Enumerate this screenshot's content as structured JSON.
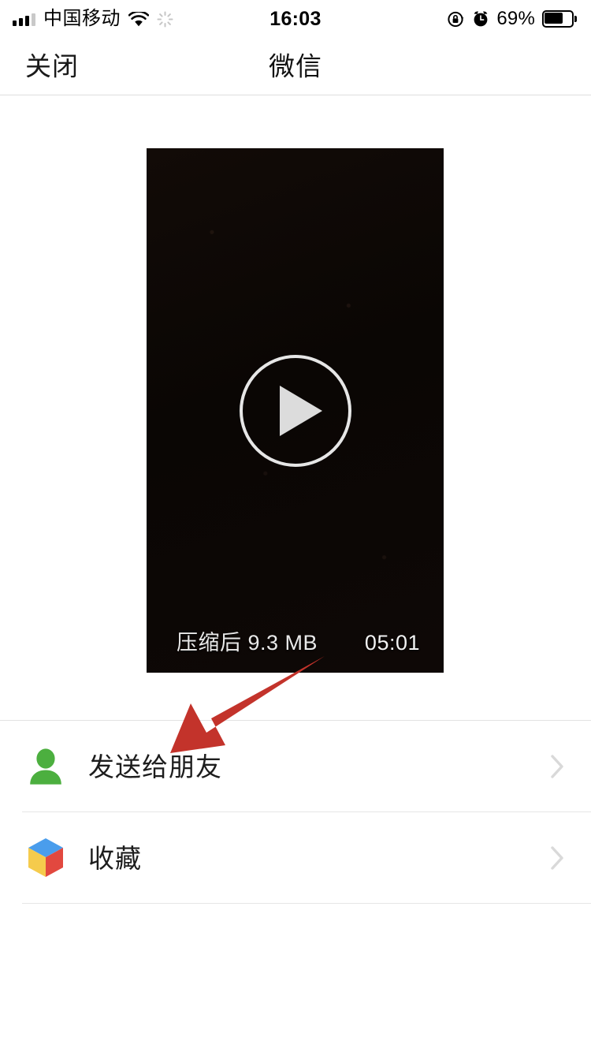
{
  "status_bar": {
    "carrier": "中国移动",
    "time": "16:03",
    "battery_percent": "69%",
    "signal_bars_filled": 3,
    "signal_bars_total": 4,
    "icons": [
      "signal-bars-icon",
      "wifi-icon",
      "activity-spinner-icon",
      "rotation-lock-icon",
      "alarm-clock-icon",
      "battery-icon"
    ]
  },
  "navbar": {
    "close_label": "关闭",
    "title": "微信"
  },
  "video": {
    "play_icon": "play-icon",
    "size_label": "压缩后 9.3 MB",
    "duration": "05:01"
  },
  "list": {
    "items": [
      {
        "label": "发送给朋友",
        "icon": "person-icon",
        "icon_color": "#4CAF3F",
        "chevron": "chevron-right-icon"
      },
      {
        "label": "收藏",
        "icon": "favorites-cube-icon",
        "icon_color": "#4A9DEC",
        "chevron": "chevron-right-icon"
      }
    ]
  },
  "annotation": {
    "arrow_color": "#C3332B",
    "arrow_name": "red-pointer-arrow"
  },
  "colors": {
    "page_bg": "#ffffff",
    "divider": "#e6e6e6",
    "text_primary": "#1d1d1d",
    "chevron": "#d2d2d2",
    "video_bg": "#0c0705",
    "green": "#4CAF3F",
    "cube_blue": "#4A9DEC",
    "cube_yellow": "#F5CB4C",
    "cube_red": "#E2483F"
  }
}
